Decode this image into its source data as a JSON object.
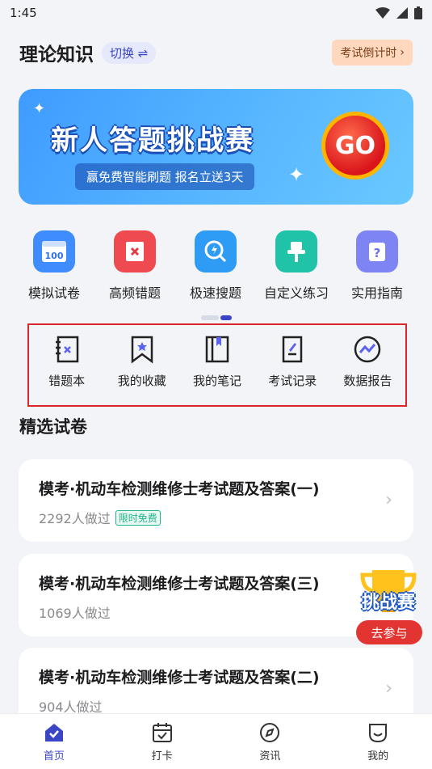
{
  "status_bar": {
    "time": "1:45"
  },
  "header": {
    "title": "理论知识",
    "switch_label": "切换 ⇌",
    "countdown_label": "考试倒计时"
  },
  "banner": {
    "title": "新人答题挑战赛",
    "subtitle": "赢免费智能刷题  报名立送3天",
    "go_label": "GO"
  },
  "quick_entries": [
    {
      "label": "模拟试卷",
      "icon": "exam-100-icon",
      "color": "#3f8cff"
    },
    {
      "label": "高频错题",
      "icon": "wrong-book-icon",
      "color": "#ef4a50"
    },
    {
      "label": "极速搜题",
      "icon": "search-bolt-icon",
      "color": "#2e9cf5"
    },
    {
      "label": "自定义练习",
      "icon": "pin-icon",
      "color": "#20c3a8"
    },
    {
      "label": "实用指南",
      "icon": "guide-icon",
      "color": "#7f84f5"
    }
  ],
  "tools": [
    {
      "label": "错题本",
      "icon": "mistake-notebook-icon"
    },
    {
      "label": "我的收藏",
      "icon": "bookmark-icon"
    },
    {
      "label": "我的笔记",
      "icon": "notes-icon"
    },
    {
      "label": "考试记录",
      "icon": "record-icon"
    },
    {
      "label": "数据报告",
      "icon": "report-icon"
    }
  ],
  "section": {
    "title": "精选试卷"
  },
  "papers": [
    {
      "title": "模考·机动车检测维修士考试题及答案(一)",
      "count": "2292人做过",
      "tag": "限时免费"
    },
    {
      "title": "模考·机动车检测维修士考试题及答案(三)",
      "count": "1069人做过",
      "tag": ""
    },
    {
      "title": "模考·机动车检测维修士考试题及答案(二)",
      "count": "904人做过",
      "tag": ""
    }
  ],
  "float_badge": {
    "title": "挑战赛",
    "action": "去参与"
  },
  "tabs": [
    {
      "label": "首页",
      "icon": "home-icon",
      "active": true
    },
    {
      "label": "打卡",
      "icon": "calendar-check-icon",
      "active": false
    },
    {
      "label": "资讯",
      "icon": "compass-icon",
      "active": false
    },
    {
      "label": "我的",
      "icon": "profile-icon",
      "active": false
    }
  ],
  "colors": {
    "accent": "#3b46c7",
    "highlight_border": "#d9252b",
    "free_tag": "#1fb48a"
  }
}
